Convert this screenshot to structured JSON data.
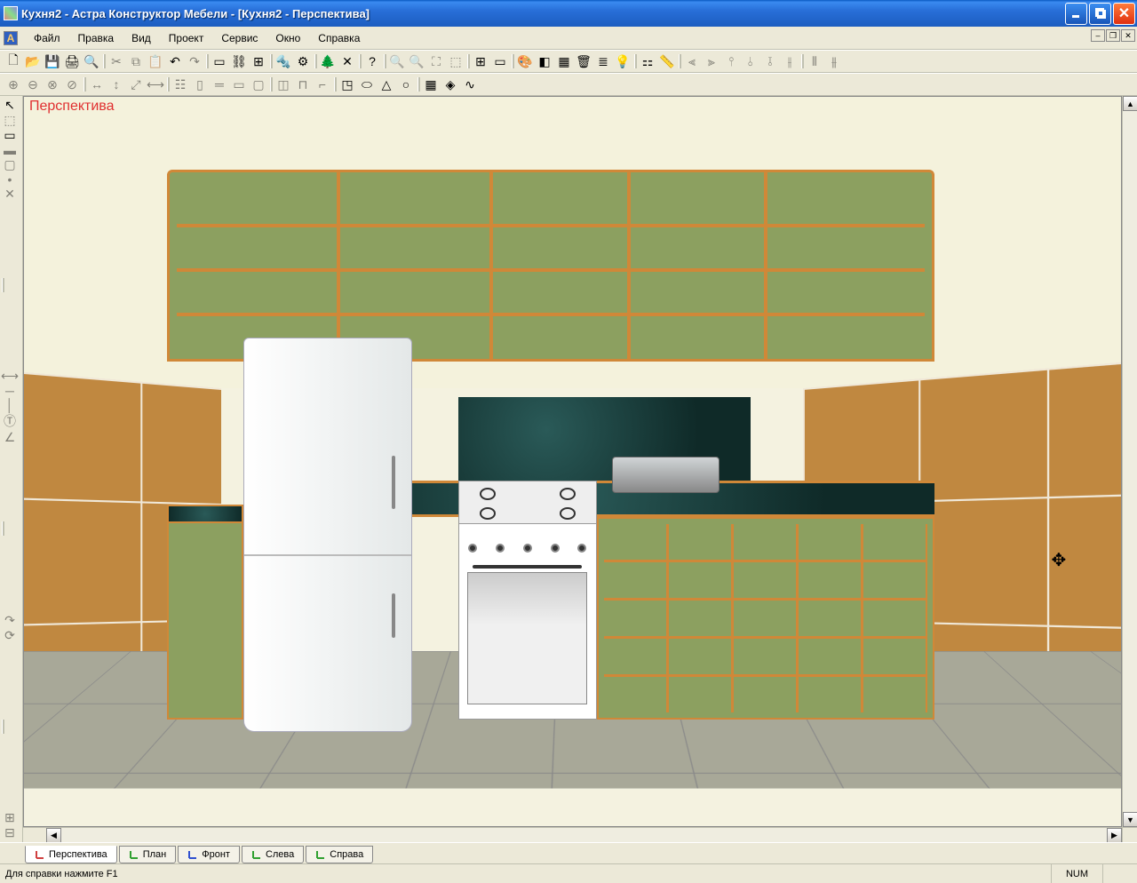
{
  "window": {
    "title": "Кухня2 - Астра Конструктор Мебели - [Кухня2 - Перспектива]"
  },
  "menu": {
    "items": [
      "Файл",
      "Правка",
      "Вид",
      "Проект",
      "Сервис",
      "Окно",
      "Справка"
    ]
  },
  "toolbars": {
    "row1": [
      {
        "name": "new-file-icon",
        "enabled": true
      },
      {
        "name": "open-file-icon",
        "enabled": true
      },
      {
        "name": "save-icon",
        "enabled": true
      },
      {
        "name": "print-icon",
        "enabled": true
      },
      {
        "name": "print-preview-icon",
        "enabled": true
      },
      {
        "sep": true
      },
      {
        "name": "cut-icon",
        "enabled": false
      },
      {
        "name": "copy-icon",
        "enabled": false
      },
      {
        "name": "paste-icon",
        "enabled": false
      },
      {
        "name": "undo-icon",
        "enabled": true
      },
      {
        "name": "redo-icon",
        "enabled": false
      },
      {
        "sep": true
      },
      {
        "name": "panel-icon",
        "enabled": true
      },
      {
        "name": "link-icon",
        "enabled": true
      },
      {
        "name": "group-icon",
        "enabled": true
      },
      {
        "sep": true
      },
      {
        "name": "screw-icon",
        "enabled": true
      },
      {
        "name": "drill-icon",
        "enabled": true
      },
      {
        "sep": true
      },
      {
        "name": "tree-icon",
        "enabled": true
      },
      {
        "name": "close-x-icon",
        "enabled": true
      },
      {
        "sep": true
      },
      {
        "name": "help-icon",
        "enabled": true
      },
      {
        "sep": true
      },
      {
        "name": "zoom-in-icon",
        "enabled": false
      },
      {
        "name": "zoom-out-icon",
        "enabled": false
      },
      {
        "name": "zoom-fit-icon",
        "enabled": false
      },
      {
        "name": "zoom-region-icon",
        "enabled": false
      },
      {
        "sep": true
      },
      {
        "name": "construct-icon",
        "enabled": true
      },
      {
        "name": "door-icon",
        "enabled": true
      },
      {
        "sep": true
      },
      {
        "name": "materials-rainbow-icon",
        "enabled": true
      },
      {
        "name": "shaded-icon",
        "enabled": true
      },
      {
        "name": "wireframe-icon",
        "enabled": true
      },
      {
        "name": "trash-icon",
        "enabled": true
      },
      {
        "name": "layers-icon",
        "enabled": true
      },
      {
        "name": "light-icon",
        "enabled": true
      },
      {
        "sep": true
      },
      {
        "name": "assembly-icon",
        "enabled": true
      },
      {
        "name": "measure-icon",
        "enabled": true
      },
      {
        "sep": true
      },
      {
        "name": "align-left-icon",
        "enabled": false
      },
      {
        "name": "align-right-icon",
        "enabled": false
      },
      {
        "name": "align-top-icon",
        "enabled": false
      },
      {
        "name": "align-bottom-icon",
        "enabled": false
      },
      {
        "name": "align-hcenter-icon",
        "enabled": false
      },
      {
        "name": "align-vcenter-icon",
        "enabled": false
      },
      {
        "sep": true
      },
      {
        "name": "distribute-h-icon",
        "enabled": false
      },
      {
        "name": "distribute-v-icon",
        "enabled": false
      }
    ],
    "row2": [
      {
        "name": "join-icon",
        "enabled": false
      },
      {
        "name": "split-icon",
        "enabled": false
      },
      {
        "name": "combine-icon",
        "enabled": false
      },
      {
        "name": "subtract-icon",
        "enabled": false
      },
      {
        "sep": true
      },
      {
        "name": "dim-h-icon",
        "enabled": false
      },
      {
        "name": "dim-v-icon",
        "enabled": false
      },
      {
        "name": "dim-align-icon",
        "enabled": false
      },
      {
        "name": "dim-icon",
        "enabled": false
      },
      {
        "sep": true
      },
      {
        "name": "structure-icon",
        "enabled": false
      },
      {
        "name": "side-panel-icon",
        "enabled": false
      },
      {
        "name": "shelf-icon",
        "enabled": false
      },
      {
        "name": "back-panel-icon",
        "enabled": false
      },
      {
        "name": "facade-icon",
        "enabled": false
      },
      {
        "sep": true
      },
      {
        "name": "detail-icon",
        "enabled": false
      },
      {
        "name": "slot-icon",
        "enabled": false
      },
      {
        "name": "edge-icon",
        "enabled": false
      },
      {
        "sep": true
      },
      {
        "name": "box3d-icon",
        "enabled": true
      },
      {
        "name": "cylinder-icon",
        "enabled": true
      },
      {
        "name": "cone-icon",
        "enabled": true
      },
      {
        "name": "sphere-icon",
        "enabled": true
      },
      {
        "sep": true
      },
      {
        "name": "texture-icon",
        "enabled": true
      },
      {
        "name": "material-icon",
        "enabled": true
      },
      {
        "name": "curve-icon",
        "enabled": true
      }
    ],
    "side": [
      {
        "name": "pointer-icon",
        "enabled": true
      },
      {
        "name": "select-icon",
        "enabled": false
      },
      {
        "name": "rectangle-icon",
        "enabled": true
      },
      {
        "name": "wall-icon",
        "enabled": false
      },
      {
        "name": "rect-outline-icon",
        "enabled": false
      },
      {
        "name": "point-icon",
        "enabled": false
      },
      {
        "name": "delete-icon",
        "enabled": false
      },
      {
        "sep": true
      },
      {
        "name": "dim-line-icon",
        "enabled": false
      },
      {
        "name": "guide-h-icon",
        "enabled": false
      },
      {
        "name": "guide-v-icon",
        "enabled": false
      },
      {
        "name": "text-dim-icon",
        "enabled": false
      },
      {
        "name": "guide-angle-icon",
        "enabled": false
      },
      {
        "sep": true
      },
      {
        "name": "redo-icon",
        "enabled": false
      },
      {
        "name": "rotate-icon",
        "enabled": false
      },
      {
        "sep": true
      },
      {
        "name": "table-icon",
        "enabled": false
      },
      {
        "name": "grid-icon",
        "enabled": false
      }
    ]
  },
  "viewport": {
    "label": "Перспектива"
  },
  "view_tabs": [
    {
      "label": "Перспектива",
      "color": "#d04040",
      "active": true
    },
    {
      "label": "План",
      "color": "#30a030"
    },
    {
      "label": "Фронт",
      "color": "#3050d0"
    },
    {
      "label": "Слева",
      "color": "#30a030"
    },
    {
      "label": "Справа",
      "color": "#30a030"
    }
  ],
  "statusbar": {
    "help_text": "Для справки нажмите F1",
    "num_indicator": "NUM"
  }
}
